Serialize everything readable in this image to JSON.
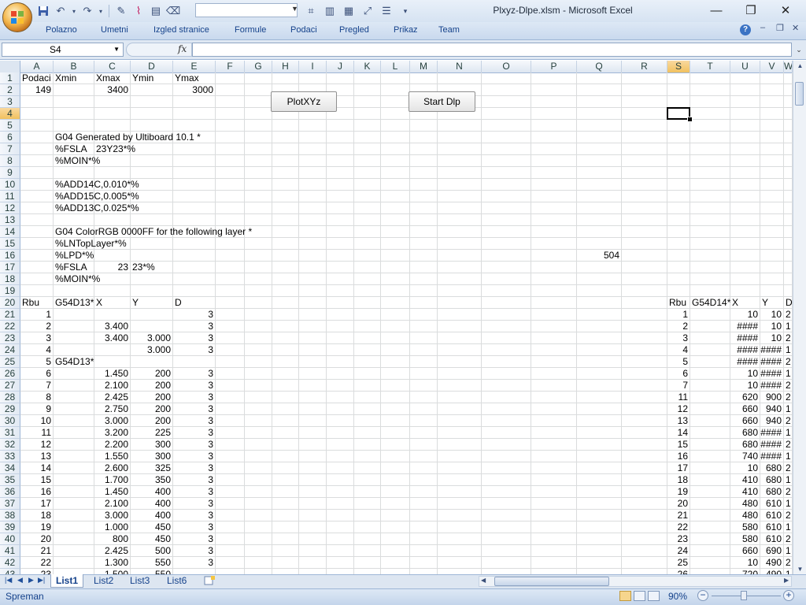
{
  "window": {
    "title": "Plxyz-Dlpe.xlsm - Microsoft Excel",
    "minimize": "—",
    "maximize": "❐",
    "close": "✕"
  },
  "ribbon": {
    "tabs": [
      "Polazno",
      "Umetni",
      "Izgled stranice",
      "Formule",
      "Podaci",
      "Pregled",
      "Prikaz",
      "Team"
    ],
    "help": "?",
    "win_min": "–",
    "win_restore": "❐",
    "win_close": "✕"
  },
  "formula_bar": {
    "name_box": "S4",
    "fx": "fx",
    "formula": ""
  },
  "columns": [
    "A",
    "B",
    "C",
    "D",
    "E",
    "F",
    "G",
    "H",
    "I",
    "J",
    "K",
    "L",
    "M",
    "N",
    "O",
    "P",
    "Q",
    "R",
    "S",
    "T",
    "U",
    "V",
    "W"
  ],
  "selected_column": "S",
  "selected_row": "4",
  "rows": [
    "1",
    "2",
    "3",
    "4",
    "5",
    "6",
    "7",
    "8",
    "9",
    "10",
    "11",
    "12",
    "13",
    "14",
    "15",
    "16",
    "17",
    "18",
    "19",
    "20",
    "21",
    "22",
    "23",
    "24",
    "25",
    "26",
    "27",
    "28",
    "29",
    "30",
    "31",
    "32",
    "33",
    "34",
    "35",
    "36",
    "37",
    "38",
    "39",
    "40",
    "41",
    "42",
    "43"
  ],
  "buttons": {
    "plot": "PlotXYz",
    "start": "Start Dlp"
  },
  "header_cells": {
    "A1": "Podaci",
    "B1": "Xmin",
    "C1": "Xmax",
    "D1": "Ymin",
    "E1": "Ymax",
    "A2": "149",
    "C2": "3400",
    "E2": "3000",
    "B6": "G04 Generated by Ultiboard 10.1 *",
    "B7": "%FSLA",
    "C7": "23Y23*%",
    "B8": "%MOIN*%",
    "B10": "%ADD14C,0.010*%",
    "B11": "%ADD15C,0.005*%",
    "B12": "%ADD13C,0.025*%",
    "B14": "G04 ColorRGB 0000FF for the following layer *",
    "B15": "%LNTopLayer*%",
    "B16": "%LPD*%",
    "Q16": "504",
    "B17": "%FSLA",
    "C17": "23",
    "D17": "23*%",
    "B18": "%MOIN*%",
    "A20": "Rbu",
    "B20": "G54D13*",
    "C20": "X",
    "D20": "Y",
    "E20": "D",
    "S20": "Rbu",
    "T20": "G54D14*",
    "U20": "X",
    "V20": "Y",
    "W20": "D",
    "B25": "G54D13*"
  },
  "left_table": [
    {
      "a": "1",
      "c": "",
      "d": "",
      "e": "3"
    },
    {
      "a": "2",
      "c": "3.400",
      "d": "",
      "e": "3"
    },
    {
      "a": "3",
      "c": "3.400",
      "d": "3.000",
      "e": "3"
    },
    {
      "a": "4",
      "c": "",
      "d": "3.000",
      "e": "3"
    },
    {
      "a": "5",
      "c": "",
      "d": "",
      "e": ""
    },
    {
      "a": "6",
      "c": "1.450",
      "d": "200",
      "e": "3"
    },
    {
      "a": "7",
      "c": "2.100",
      "d": "200",
      "e": "3"
    },
    {
      "a": "8",
      "c": "2.425",
      "d": "200",
      "e": "3"
    },
    {
      "a": "9",
      "c": "2.750",
      "d": "200",
      "e": "3"
    },
    {
      "a": "10",
      "c": "3.000",
      "d": "200",
      "e": "3"
    },
    {
      "a": "11",
      "c": "3.200",
      "d": "225",
      "e": "3"
    },
    {
      "a": "12",
      "c": "2.200",
      "d": "300",
      "e": "3"
    },
    {
      "a": "13",
      "c": "1.550",
      "d": "300",
      "e": "3"
    },
    {
      "a": "14",
      "c": "2.600",
      "d": "325",
      "e": "3"
    },
    {
      "a": "15",
      "c": "1.700",
      "d": "350",
      "e": "3"
    },
    {
      "a": "16",
      "c": "1.450",
      "d": "400",
      "e": "3"
    },
    {
      "a": "17",
      "c": "2.100",
      "d": "400",
      "e": "3"
    },
    {
      "a": "18",
      "c": "3.000",
      "d": "400",
      "e": "3"
    },
    {
      "a": "19",
      "c": "1.000",
      "d": "450",
      "e": "3"
    },
    {
      "a": "20",
      "c": "800",
      "d": "450",
      "e": "3"
    },
    {
      "a": "21",
      "c": "2.425",
      "d": "500",
      "e": "3"
    },
    {
      "a": "22",
      "c": "1.300",
      "d": "550",
      "e": "3"
    },
    {
      "a": "23",
      "c": "1.500",
      "d": "550",
      "e": ""
    }
  ],
  "right_table": [
    {
      "s": "1",
      "u": "10",
      "v": "10",
      "w": "2"
    },
    {
      "s": "2",
      "u": "####",
      "v": "10",
      "w": "1"
    },
    {
      "s": "3",
      "u": "####",
      "v": "10",
      "w": "2"
    },
    {
      "s": "4",
      "u": "####",
      "v": "####",
      "w": "1"
    },
    {
      "s": "5",
      "u": "####",
      "v": "####",
      "w": "2"
    },
    {
      "s": "6",
      "u": "10",
      "v": "####",
      "w": "1"
    },
    {
      "s": "7",
      "u": "10",
      "v": "####",
      "w": "2"
    },
    {
      "s": "11",
      "u": "620",
      "v": "900",
      "w": "2"
    },
    {
      "s": "12",
      "u": "660",
      "v": "940",
      "w": "1"
    },
    {
      "s": "13",
      "u": "660",
      "v": "940",
      "w": "2"
    },
    {
      "s": "14",
      "u": "680",
      "v": "####",
      "w": "1"
    },
    {
      "s": "15",
      "u": "680",
      "v": "####",
      "w": "2"
    },
    {
      "s": "16",
      "u": "740",
      "v": "####",
      "w": "1"
    },
    {
      "s": "17",
      "u": "10",
      "v": "680",
      "w": "2"
    },
    {
      "s": "18",
      "u": "410",
      "v": "680",
      "w": "1"
    },
    {
      "s": "19",
      "u": "410",
      "v": "680",
      "w": "2"
    },
    {
      "s": "20",
      "u": "480",
      "v": "610",
      "w": "1"
    },
    {
      "s": "21",
      "u": "480",
      "v": "610",
      "w": "2"
    },
    {
      "s": "22",
      "u": "580",
      "v": "610",
      "w": "1"
    },
    {
      "s": "23",
      "u": "580",
      "v": "610",
      "w": "2"
    },
    {
      "s": "24",
      "u": "660",
      "v": "690",
      "w": "1"
    },
    {
      "s": "25",
      "u": "10",
      "v": "490",
      "w": "2"
    },
    {
      "s": "26",
      "u": "720",
      "v": "490",
      "w": "1"
    }
  ],
  "sheet_tabs": [
    "List1",
    "List2",
    "List3",
    "List6"
  ],
  "active_sheet": "List1",
  "status": {
    "mode": "Spreman",
    "zoom": "90%",
    "zoom_minus": "−",
    "zoom_plus": "+"
  }
}
